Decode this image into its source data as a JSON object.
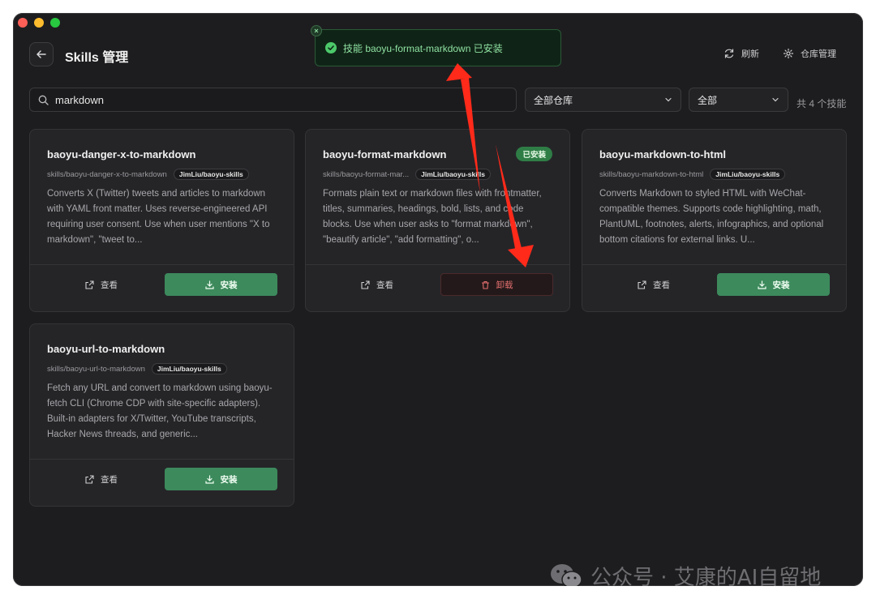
{
  "header": {
    "title": "Skills 管理",
    "refresh_label": "刷新",
    "repo_manage_label": "仓库管理"
  },
  "toast": {
    "message": "技能 baoyu-format-markdown 已安装"
  },
  "filters": {
    "search_value": "markdown",
    "repo_select": "全部仓库",
    "status_select": "全部",
    "count_text": "共 4 个技能"
  },
  "cards": [
    {
      "name": "baoyu-danger-x-to-markdown",
      "path": "skills/baoyu-danger-x-to-markdown",
      "repo": "JimLiu/baoyu-skills",
      "description": "Converts X (Twitter) tweets and articles to markdown with YAML front matter. Uses reverse-engineered API requiring user consent. Use when user mentions \"X to markdown\", \"tweet to...",
      "view_label": "查看",
      "action_label": "安装",
      "installed": false
    },
    {
      "name": "baoyu-format-markdown",
      "path": "skills/baoyu-format-mar...",
      "repo": "JimLiu/baoyu-skills",
      "description": "Formats plain text or markdown files with frontmatter, titles, summaries, headings, bold, lists, and code blocks. Use when user asks to \"format markdown\", \"beautify article\", \"add formatting\", o...",
      "view_label": "查看",
      "action_label": "卸载",
      "installed": true,
      "badge": "已安装"
    },
    {
      "name": "baoyu-markdown-to-html",
      "path": "skills/baoyu-markdown-to-html",
      "repo": "JimLiu/baoyu-skills",
      "description": "Converts Markdown to styled HTML with WeChat-compatible themes. Supports code highlighting, math, PlantUML, footnotes, alerts, infographics, and optional bottom citations for external links. U...",
      "view_label": "查看",
      "action_label": "安装",
      "installed": false
    },
    {
      "name": "baoyu-url-to-markdown",
      "path": "skills/baoyu-url-to-markdown",
      "repo": "JimLiu/baoyu-skills",
      "description": "Fetch any URL and convert to markdown using baoyu-fetch CLI (Chrome CDP with site-specific adapters). Built-in adapters for X/Twitter, YouTube transcripts, Hacker News threads, and generic...",
      "view_label": "查看",
      "action_label": "安装",
      "installed": false
    }
  ],
  "watermark": {
    "text": "公众号 · 艾康的AI自留地"
  },
  "colors": {
    "background": "#1d1d1f",
    "card": "#252528",
    "accent_green": "#3d8a5c",
    "danger_red": "#e26e6e",
    "annotation_arrow": "#ff2a1a"
  }
}
